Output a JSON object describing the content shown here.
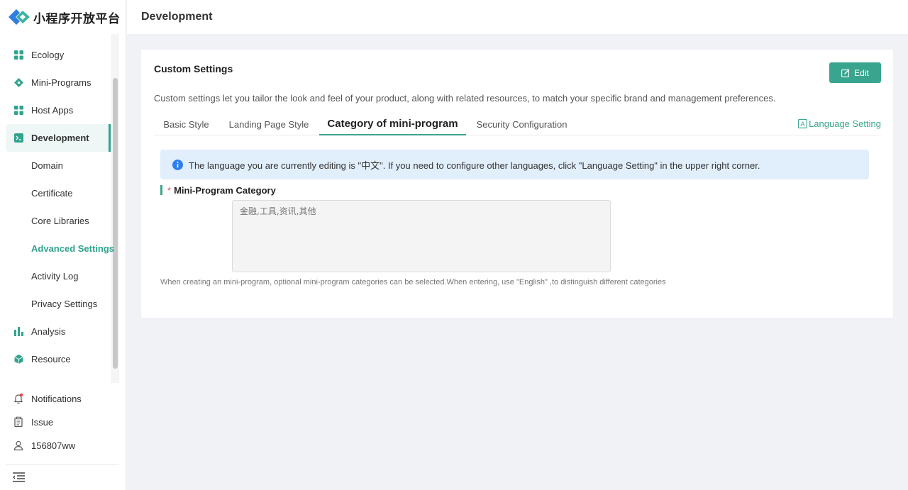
{
  "app": {
    "logo_text": "小程序开放平台",
    "accent_color": "#30a38f"
  },
  "sidebar": {
    "items": [
      {
        "label": "Ecology",
        "icon": "grid-icon"
      },
      {
        "label": "Mini-Programs",
        "icon": "diamond-icon"
      },
      {
        "label": "Host Apps",
        "icon": "grid-icon"
      },
      {
        "label": "Development",
        "icon": "terminal-icon",
        "active": true
      },
      {
        "label": "Domain",
        "sub": true
      },
      {
        "label": "Certificate",
        "sub": true
      },
      {
        "label": "Core Libraries",
        "sub": true
      },
      {
        "label": "Advanced Settings",
        "sub": true,
        "current": true
      },
      {
        "label": "Activity Log",
        "sub": true
      },
      {
        "label": "Privacy Settings",
        "sub": true
      },
      {
        "label": "Analysis",
        "icon": "bar-chart-icon"
      },
      {
        "label": "Resource",
        "icon": "cube-icon"
      }
    ],
    "bottom": {
      "notifications": "Notifications",
      "issue": "Issue",
      "user": "156807ww"
    }
  },
  "header": {
    "title": "Development"
  },
  "card": {
    "title": "Custom Settings",
    "edit_label": "Edit",
    "description": "Custom settings let you tailor the look and feel of your product, along with related resources, to match your specific brand and management preferences.",
    "tabs": [
      {
        "label": "Basic Style"
      },
      {
        "label": "Landing Page Style"
      },
      {
        "label": "Category of mini-program",
        "active": true
      },
      {
        "label": "Security Configuration"
      }
    ],
    "language_setting": "Language Setting",
    "alert": "The language you are currently editing is \"中文\". If you need to configure other languages, click \"Language Setting\" in the upper right corner.",
    "field": {
      "required_mark": "*",
      "label": "Mini-Program Category",
      "placeholder": "金融,工具,资讯,其他",
      "help": "When creating an mini-program, optional mini-program categories can be selected.When entering, use \"English\" ,to distinguish different categories"
    }
  }
}
